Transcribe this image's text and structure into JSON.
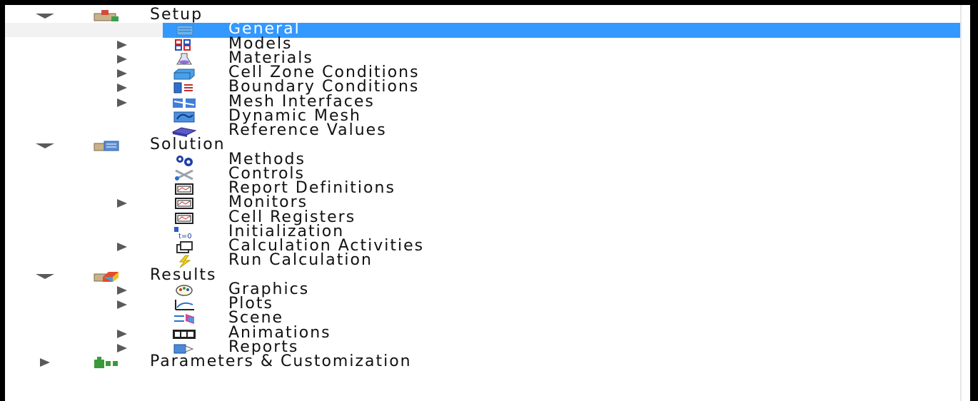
{
  "tree": [
    {
      "label": "Setup",
      "icon": "setup-icon",
      "arrow": "down",
      "level": 0
    },
    {
      "label": "General",
      "icon": "general-icon",
      "arrow": "none",
      "level": 1,
      "selected": true
    },
    {
      "label": "Models",
      "icon": "models-icon",
      "arrow": "right",
      "level": 1
    },
    {
      "label": "Materials",
      "icon": "materials-icon",
      "arrow": "right",
      "level": 1
    },
    {
      "label": "Cell Zone Conditions",
      "icon": "cell-zone-icon",
      "arrow": "right",
      "level": 1
    },
    {
      "label": "Boundary Conditions",
      "icon": "boundary-icon",
      "arrow": "right",
      "level": 1
    },
    {
      "label": "Mesh Interfaces",
      "icon": "mesh-interfaces-icon",
      "arrow": "right",
      "level": 1
    },
    {
      "label": "Dynamic Mesh",
      "icon": "dynamic-mesh-icon",
      "arrow": "none",
      "level": 1
    },
    {
      "label": "Reference Values",
      "icon": "reference-values-icon",
      "arrow": "none",
      "level": 1
    },
    {
      "label": "Solution",
      "icon": "solution-icon",
      "arrow": "down",
      "level": 0
    },
    {
      "label": "Methods",
      "icon": "methods-icon",
      "arrow": "none",
      "level": 1
    },
    {
      "label": "Controls",
      "icon": "controls-icon",
      "arrow": "none",
      "level": 1
    },
    {
      "label": "Report Definitions",
      "icon": "report-definitions-icon",
      "arrow": "none",
      "level": 1
    },
    {
      "label": "Monitors",
      "icon": "monitors-icon",
      "arrow": "right",
      "level": 1
    },
    {
      "label": "Cell Registers",
      "icon": "cell-registers-icon",
      "arrow": "none",
      "level": 1
    },
    {
      "label": "Initialization",
      "icon": "initialization-icon",
      "arrow": "none",
      "level": 1
    },
    {
      "label": "Calculation Activities",
      "icon": "calculation-activities-icon",
      "arrow": "right",
      "level": 1
    },
    {
      "label": "Run Calculation",
      "icon": "run-calculation-icon",
      "arrow": "none",
      "level": 1
    },
    {
      "label": "Results",
      "icon": "results-icon",
      "arrow": "down",
      "level": 0
    },
    {
      "label": "Graphics",
      "icon": "graphics-icon",
      "arrow": "right",
      "level": 1
    },
    {
      "label": "Plots",
      "icon": "plots-icon",
      "arrow": "right",
      "level": 1
    },
    {
      "label": "Scene",
      "icon": "scene-icon",
      "arrow": "none",
      "level": 1
    },
    {
      "label": "Animations",
      "icon": "animations-icon",
      "arrow": "right",
      "level": 1
    },
    {
      "label": "Reports",
      "icon": "reports-icon",
      "arrow": "right",
      "level": 1
    },
    {
      "label": "Parameters & Customization",
      "icon": "parameters-icon",
      "arrow": "right",
      "level": 0
    }
  ],
  "colors": {
    "selection": "#3399ff",
    "text": "#111111",
    "arrow": "#5a5a5a"
  }
}
